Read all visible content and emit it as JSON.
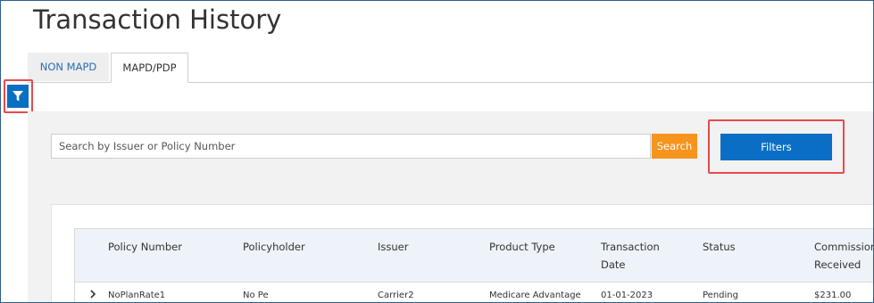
{
  "page": {
    "title": "Transaction History"
  },
  "tabs": [
    {
      "label": "NON MAPD",
      "active": false
    },
    {
      "label": "MAPD/PDP",
      "active": true
    }
  ],
  "filter_toggle": {
    "icon": "filter-icon"
  },
  "search": {
    "placeholder": "Search by Issuer or Policy Number",
    "value": "",
    "button_label": "Search"
  },
  "filters_button": {
    "label": "Filters"
  },
  "table": {
    "columns": [
      "Policy Number",
      "Policyholder",
      "Issuer",
      "Product Type",
      "Transaction Date",
      "Status",
      "Commission Received"
    ],
    "rows": [
      {
        "policy_number": "NoPlanRate1",
        "policyholder": "No Pe",
        "issuer": "Carrier2",
        "product_type": "Medicare Advantage",
        "transaction_date": "01-01-2023",
        "status": "Pending",
        "commission_received": "$231.00"
      }
    ]
  },
  "colors": {
    "accent_blue": "#0a6fc4",
    "search_orange": "#f7941d",
    "highlight_red": "#e84a4a",
    "tab_link_blue": "#2a6db5"
  }
}
